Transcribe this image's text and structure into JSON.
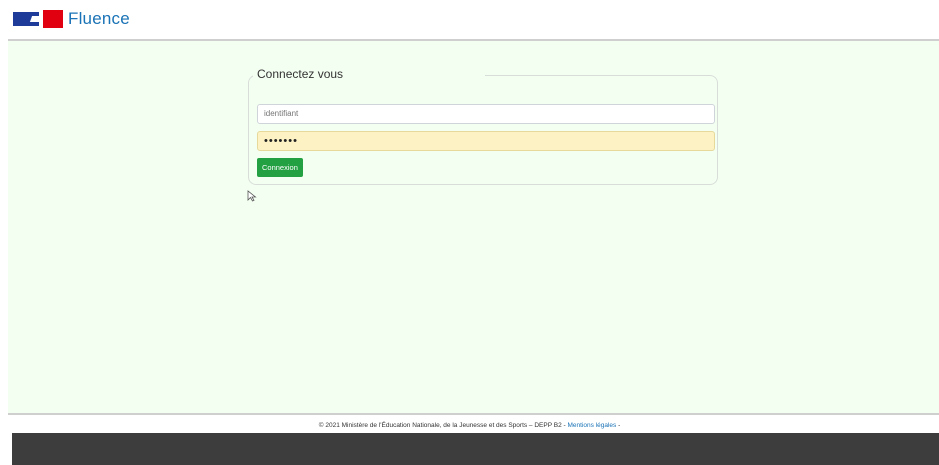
{
  "header": {
    "brand": "Fluence",
    "logo_icon": "marianne-logo-icon"
  },
  "login": {
    "legend": "Connectez vous",
    "identifiant_placeholder": "identifiant",
    "password_value": "•••••••",
    "submit_label": "Connexion"
  },
  "footer": {
    "copyright": "© 2021 Ministère de l'Éducation Nationale, de la Jeunesse et des Sports – DEPP B2 -",
    "legal_link": "Mentions légales",
    "trailing": "-"
  },
  "colors": {
    "brand_blue": "#1a73b6",
    "background": "#f3fff1",
    "button_green": "#23a042",
    "autofill_yellow": "#fcf2c4",
    "footer_dark": "#3d3d3d"
  }
}
